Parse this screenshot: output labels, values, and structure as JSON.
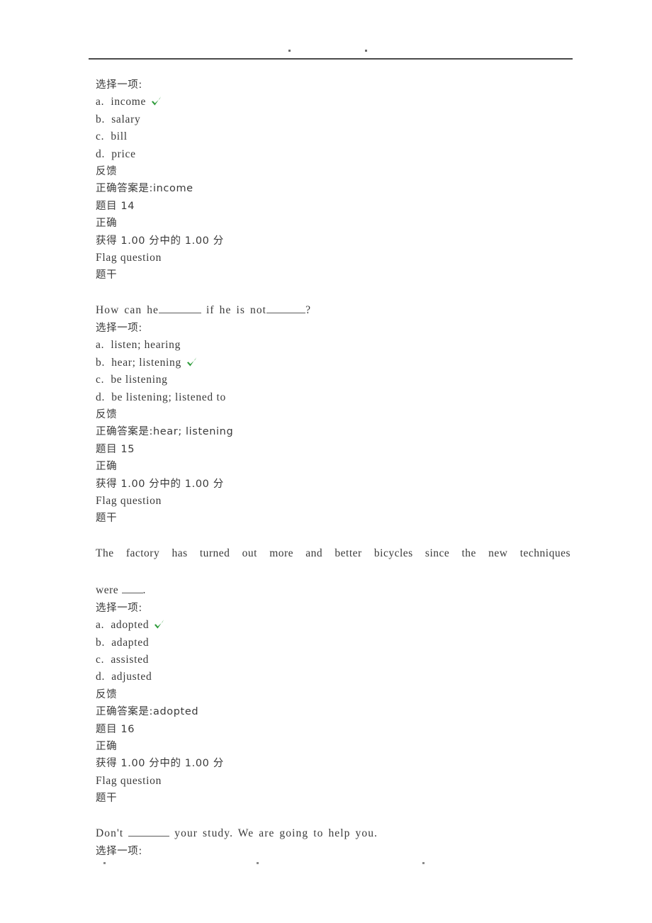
{
  "document": {
    "header": {
      "marks": [
        "dot-mark",
        "dot-mark"
      ]
    },
    "footer": {
      "marks": [
        "dot-mark",
        "dot-mark",
        "dot-mark"
      ]
    },
    "labels": {
      "choose_one": "选择一项:",
      "feedback": "反馈",
      "correct_answer_prefix": "正确答案是:",
      "status_correct": "正确",
      "flag_question": "Flag question",
      "question_stem": "题干"
    },
    "blocks": [
      {
        "choose_one": "选择一项:",
        "options": [
          {
            "label": "a.",
            "text": "income",
            "checked": true
          },
          {
            "label": "b.",
            "text": "salary",
            "checked": false
          },
          {
            "label": "c.",
            "text": "bill",
            "checked": false
          },
          {
            "label": "d.",
            "text": "price",
            "checked": false
          }
        ],
        "feedback": "反馈",
        "correct_answer": "正确答案是:income",
        "question_number": "题目 14",
        "status": "正确",
        "grade": "获得 1.00 分中的 1.00 分",
        "flag": "Flag question",
        "stem_label": "题干",
        "stem_segments": [
          "How can he",
          "_blank60_",
          " if he is not",
          "_blank55_",
          "?"
        ],
        "stem_plain": "How can he________ if he is not________?"
      },
      {
        "choose_one": "选择一项:",
        "options": [
          {
            "label": "a.",
            "text": "listen; hearing",
            "checked": false
          },
          {
            "label": "b.",
            "text": "hear; listening",
            "checked": true
          },
          {
            "label": "c.",
            "text": "be listening",
            "checked": false
          },
          {
            "label": "d.",
            "text": "be listening; listened to",
            "checked": false
          }
        ],
        "feedback": "反馈",
        "correct_answer": "正确答案是:hear; listening",
        "question_number": "题目 15",
        "status": "正确",
        "grade": "获得 1.00 分中的 1.00 分",
        "flag": "Flag question",
        "stem_label": "题干",
        "stem_line_1": "The factory has turned out more and better bicycles since the new techniques",
        "stem_line_2_prefix": "were ",
        "stem_line_2_suffix": "."
      },
      {
        "choose_one": "选择一项:",
        "options": [
          {
            "label": "a.",
            "text": "adopted",
            "checked": true
          },
          {
            "label": "b.",
            "text": "adapted",
            "checked": false
          },
          {
            "label": "c.",
            "text": "assisted",
            "checked": false
          },
          {
            "label": "d.",
            "text": "adjusted",
            "checked": false
          }
        ],
        "feedback": "反馈",
        "correct_answer": "正确答案是:adopted",
        "question_number": "题目 16",
        "status": "正确",
        "grade": "获得 1.00 分中的 1.00 分",
        "flag": "Flag question",
        "stem_label": "题干",
        "stem_prefix": "Don't ",
        "stem_suffix": " your study. We are going to help you.",
        "choose_one_tail": "选择一项:"
      }
    ]
  },
  "colors": {
    "check_green": "#2d9b3a",
    "text": "#3a3a3a",
    "rule": "#4a4a4a"
  }
}
